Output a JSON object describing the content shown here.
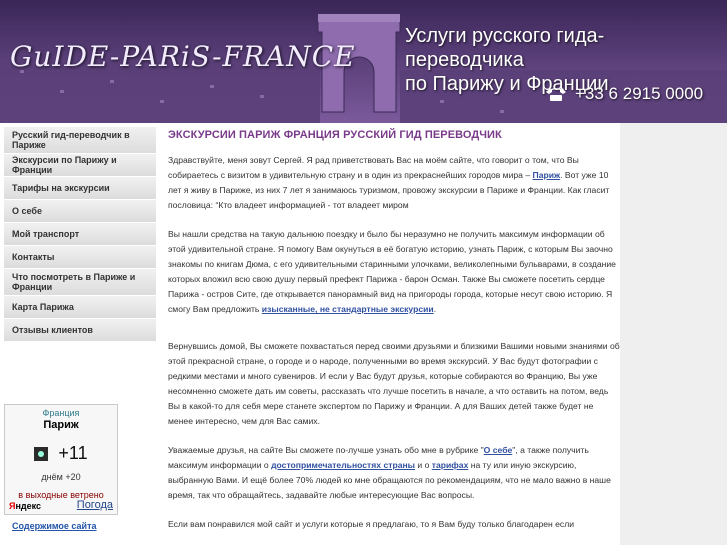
{
  "header": {
    "logo_text": "GuIDE-PARiS-FRANCE",
    "tagline_line1": "Услуги русского гида-переводчика",
    "tagline_line2": "по Парижу и Франции",
    "phone": "+33 6 2915 0000"
  },
  "nav": {
    "items": [
      "Русский гид-переводчик в Париже",
      "Экскурсии по Парижу и Франции",
      "Тарифы на экскурсии",
      "О себе",
      "Мой транспорт",
      "Контакты",
      "Что посмотреть в Париже и Франции",
      "Карта Парижа",
      "Отзывы клиентов"
    ]
  },
  "weather": {
    "country": "Франция",
    "city": "Париж",
    "temp_day": "+11",
    "night_label": "днём +20",
    "description": "в выходные ветрено",
    "provider_y": "Я",
    "provider_rest": "ндекс",
    "forecast_link": "Погода"
  },
  "sidebar": {
    "site_map": "Содержимое сайта"
  },
  "content": {
    "title": "ЭКСКУРСИИ ПАРИЖ ФРАНЦИЯ РУССКИЙ ГИД ПЕРЕВОДЧИК",
    "p1_a": "Здравствуйте, меня зовут Сергей. Я рад приветствовать Вас на моём сайте, что говорит о том, что Вы собираетесь с визитом в удивительную страну и в один из прекраснейших городов мира – ",
    "p1_link": "Париж",
    "p1_b": ". Вот уже 10 лет я живу в Париже, из них 7 лет я занимаюсь туризмом, провожу экскурсии в Париже и Франции. Как гласит пословица: “Кто владеет информацией - тот владеет миром",
    "p2_a": "Вы нашли средства на такую дальнюю поездку и было бы неразумно не получить максимум информации об этой удивительной стране. Я помогу Вам окунуться в её богатую историю, узнать Париж, с которым Вы заочно знакомы по книгам Дюма, с его удивительными старинными улочками, великолепными бульварами, в создание которых вложил всю свою душу первый префект Парижа - барон Осман. Также Вы сможете посетить сердце Парижа - остров Сите, где открывается панорамный вид на пригороды города, которые несут свою историю. Я смогу Вам предложить ",
    "p2_link": "изысканные, не стандартные экскурсии",
    "p2_b": ".",
    "p3": " Вернувшись домой, Вы сможете похвастаться перед своими друзьями и близкими Вашими новыми знаниями об этой прекрасной стране, о городе и о народе, полученными во время экскурсий. У Вас будут фотографии с редкими местами и много сувениров. И если у Вас будут друзья, которые собираются во Францию, Вы уже несомненно сможете дать им советы, рассказать что лучше посетить в начале, а что оставить на потом, ведь Вы в какой-то для себя мере станете экспертом по Парижу и Франции. А для Ваших детей также будет не менее интересно, чем для Вас самих.",
    "p4_a": "Уважаемые друзья, на сайте Вы сможете по-лучше узнать обо мне в рубрике \"",
    "p4_link1": "О себе",
    "p4_b": "\", а также получить максимум информации о ",
    "p4_link2": "достопримечательностях страны",
    "p4_c": " и о ",
    "p4_link3": "тарифах",
    "p4_d": " на ту или иную экскурсию, выбранную Вами. И ещё более 70% людей ко мне обращаются по рекомендациям, что не мало важно в наше время, так что обращайтесь, задавайте любые интересующие Вас вопросы.",
    "p5": "Если вам понравился мой сайт и услуги которые я предлагаю, то я Вам буду только благодарен если"
  }
}
